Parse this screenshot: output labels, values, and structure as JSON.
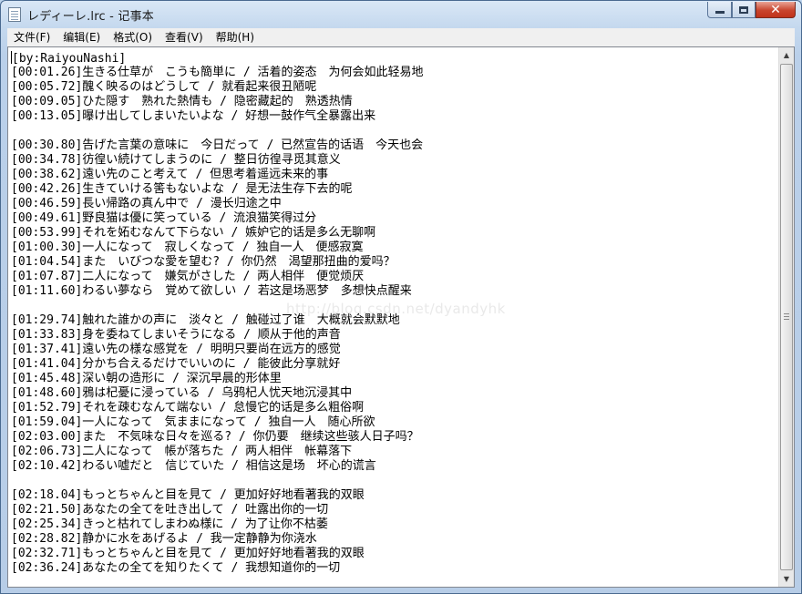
{
  "window": {
    "title": "レディーレ.lrc - 记事本"
  },
  "menu": [
    "文件(F)",
    "编辑(E)",
    "格式(O)",
    "查看(V)",
    "帮助(H)"
  ],
  "caption_buttons": {
    "minimize_icon": "minimize-icon",
    "maximize_icon": "maximize-icon",
    "close_icon": "close-icon"
  },
  "colors": {
    "title_gradient_top": "#d9e7f6",
    "close_button": "#c8442d",
    "editor_background": "#ffffff"
  },
  "lines": [
    "[by:RaiyouNashi]",
    "[00:01.26]生きる仕草が　こうも簡単に / 活着的姿态　为何会如此轻易地",
    "[00:05.72]醜く映るのはどうして / 就看起来很丑陋呢",
    "[00:09.05]ひた隠す　熟れた熱情も / 隐密藏起的　熟透热情",
    "[00:13.05]曝け出してしまいたいよな / 好想一鼓作气全暴露出来",
    "",
    "[00:30.80]告げた言葉の意味に　今日だって / 已然宣告的话语　今天也会",
    "[00:34.78]彷徨い続けてしまうのに / 整日彷徨寻觅其意义",
    "[00:38.62]遠い先のこと考えて / 但思考着遥远未来的事",
    "[00:42.26]生きていける筈もないよな / 是无法生存下去的呢",
    "[00:46.59]長い帰路の真ん中で / 漫长归途之中",
    "[00:49.61]野良猫は優に笑っている / 流浪猫笑得过分",
    "[00:53.99]それを妬むなんて下らない / 嫉妒它的话是多么无聊啊",
    "[01:00.30]一人になって　寂しくなって / 独自一人　便感寂寞",
    "[01:04.54]また　いびつな愛を望む? / 你仍然　渴望那扭曲的爱吗？",
    "[01:07.87]二人になって　嫌気がさした / 两人相伴　便觉烦厌",
    "[01:11.60]わるい夢なら　覚めて欲しい / 若这是场恶梦　多想快点醒来",
    "",
    "[01:29.74]触れた誰かの声に　淡々と / 触碰过了谁　大概就会默默地",
    "[01:33.83]身を委ねてしまいそうになる / 顺从于他的声音",
    "[01:37.41]遠い先の様な感覚を / 明明只要尚在远方的感觉",
    "[01:41.04]分かち合えるだけでいいのに / 能彼此分享就好",
    "[01:45.48]深い朝の造形に / 深沉早晨的形体里",
    "[01:48.60]鴉は杞憂に浸っている / 乌鸦杞人忧天地沉浸其中",
    "[01:52.79]それを疎むなんて端ない / 怠慢它的话是多么粗俗啊",
    "[01:59.04]一人になって　気ままになって / 独自一人　随心所欲",
    "[02:03.00]また　不気味な日々を巡る? / 你仍要　继续这些骇人日子吗？",
    "[02:06.73]二人になって　帳が落ちた / 两人相伴　帐幕落下",
    "[02:10.42]わるい嘘だと　信じていた / 相信这是场　坏心的谎言",
    "",
    "[02:18.04]もっとちゃんと目を見て / 更加好好地看著我的双眼",
    "[02:21.50]あなたの全てを吐き出して / 吐露出你的一切",
    "[02:25.34]きっと枯れてしまわぬ様に / 为了让你不枯萎",
    "[02:28.82]静かに水をあげるよ / 我一定静静为你浇水",
    "[02:32.71]もっとちゃんと目を見て / 更加好好地看著我的双眼",
    "[02:36.24]あなたの全てを知りたくて / 我想知道你的一切"
  ],
  "watermark": "http://blog.csdn.net/dyandyhk"
}
